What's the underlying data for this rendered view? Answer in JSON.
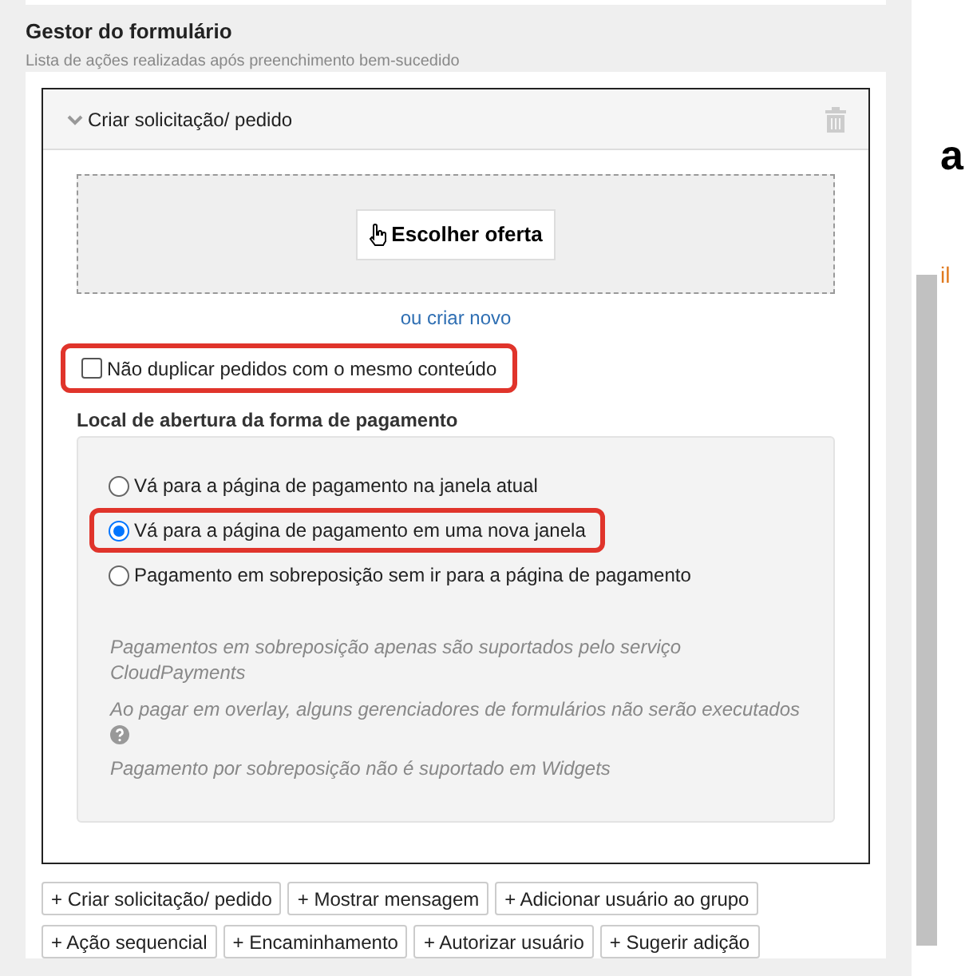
{
  "page_header": {
    "title": "Gestor do formulário",
    "subtitle": "Lista de ações realizadas após preenchimento bem-sucedido"
  },
  "action_card": {
    "title": "Criar solicitação/ pedido",
    "expanded": true,
    "choose_button": "Escolher oferta",
    "create_link": "ou criar novo",
    "no_duplicate": {
      "label": "Não duplicar pedidos com o mesmo conteúdo",
      "checked": false,
      "highlighted": true
    },
    "payment_section": {
      "heading": "Local de abertura da forma de pagamento",
      "options": [
        {
          "label": "Vá para a página de pagamento na janela atual",
          "selected": false,
          "highlighted": false
        },
        {
          "label": "Vá para a página de pagamento em uma nova janela",
          "selected": true,
          "highlighted": true
        },
        {
          "label": "Pagamento em sobreposição sem ir para a página de pagamento",
          "selected": false,
          "highlighted": false
        }
      ],
      "notes": [
        {
          "text": "Pagamentos em sobreposição apenas são suportados pelo serviço CloudPayments",
          "help_icon": false
        },
        {
          "text": "Ao pagar em overlay, alguns gerenciadores de formulários não serão executados",
          "help_icon": true
        },
        {
          "text": "Pagamento por sobreposição não é suportado em Widgets",
          "help_icon": false
        }
      ]
    }
  },
  "add_buttons": [
    "+ Criar solicitação/ pedido",
    "+ Mostrar mensagem",
    "+ Adicionar usuário ao grupo",
    "+ Ação sequencial",
    "+ Encaminhamento",
    "+ Autorizar usuário",
    "+ Sugerir adição"
  ],
  "side_texts": [
    {
      "text": "a",
      "kind": "heading"
    },
    {
      "text": "il",
      "kind": "link"
    }
  ]
}
